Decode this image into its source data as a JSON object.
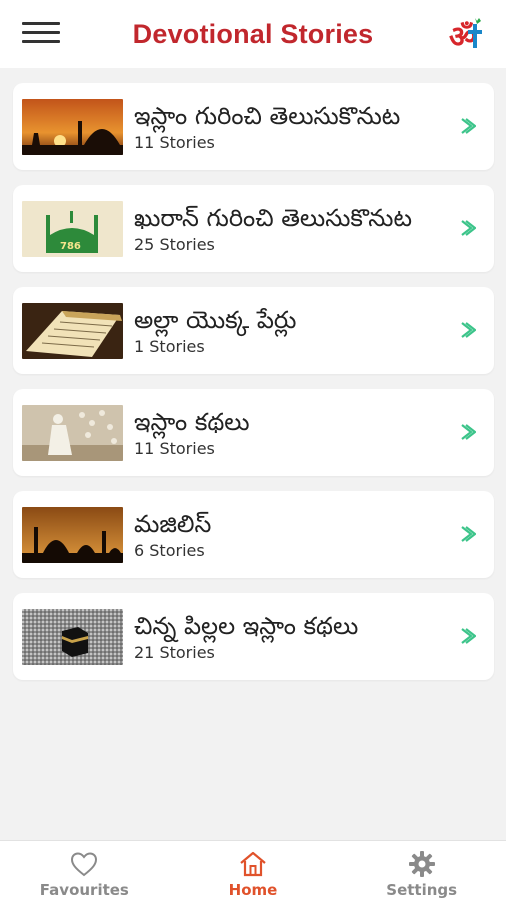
{
  "header": {
    "title": "Devotional Stories",
    "menu_icon": "hamburger-menu-icon",
    "logo_icon": "om-cross-logo-icon",
    "title_color": "#c1272d"
  },
  "categories": [
    {
      "title": "ఇస్లాం గురించి తెలుసుకొనుట",
      "count": "11 Stories",
      "thumb": "sunset-mosque-image"
    },
    {
      "title": "ఖురాన్ గురించి తెలుసుకొనుట",
      "count": "25 Stories",
      "thumb": "green-mosque-786-image"
    },
    {
      "title": "అల్లా యొక్క పేర్లు",
      "count": "1 Stories",
      "thumb": "quran-book-image"
    },
    {
      "title": "ఇస్లాం కథలు",
      "count": "11 Stories",
      "thumb": "praying-man-image"
    },
    {
      "title": "మజిలిస్",
      "count": "6 Stories",
      "thumb": "mosque-silhouette-image"
    },
    {
      "title": "చిన్న పిల్లల ఇస్లాం కథలు",
      "count": "21 Stories",
      "thumb": "kaaba-crowd-image"
    }
  ],
  "chevron_color": "#3cc48a",
  "tabs": [
    {
      "label": "Favourites",
      "icon": "heart-icon"
    },
    {
      "label": "Home",
      "icon": "home-icon"
    },
    {
      "label": "Settings",
      "icon": "gear-icon"
    }
  ],
  "active_tab_color": "#e0522b"
}
